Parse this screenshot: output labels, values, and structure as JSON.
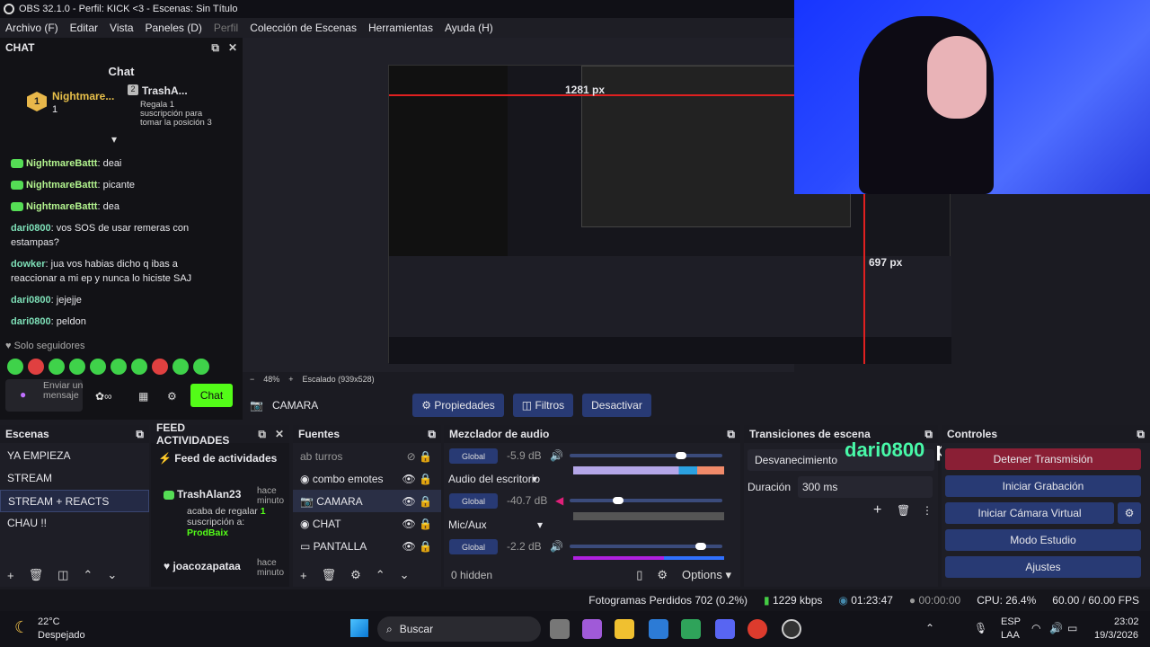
{
  "window": {
    "title": "OBS 32.1.0 - Perfil: KICK <3 - Escenas: Sin Título"
  },
  "menu": [
    "Archivo (F)",
    "Editar",
    "Vista",
    "Paneles (D)",
    "Perfil",
    "Colección de Escenas",
    "Herramientas",
    "Ayuda (H)"
  ],
  "chat": {
    "dock_title": "CHAT",
    "title": "Chat",
    "leader1": {
      "name": "Nightmare...",
      "count": "1",
      "rank": "1"
    },
    "leader2": {
      "name": "TrashA...",
      "count": "1",
      "rank": "2"
    },
    "gift_text": "Regala 1 suscripción para tomar la posición 3",
    "messages": [
      {
        "user": "NightmareBattt",
        "text": "deai",
        "type": "g"
      },
      {
        "user": "NightmareBattt",
        "text": "picante",
        "type": "g"
      },
      {
        "user": "NightmareBattt",
        "text": "dea",
        "type": "g"
      },
      {
        "user": "dari0800",
        "text": "vos SOS de usar remeras con estampas?",
        "type": "c"
      },
      {
        "user": "dowker",
        "text": "jua vos habias dicho q ibas a reaccionar a mi ep y nunca lo hiciste SAJ",
        "type": "c"
      },
      {
        "user": "dari0800",
        "text": "jejejje",
        "type": "c"
      },
      {
        "user": "dari0800",
        "text": "peldon",
        "type": "c"
      }
    ],
    "followers_only": "Solo seguidores",
    "input_placeholder": "Enviar un mensaje",
    "send_label": "Chat"
  },
  "preview": {
    "zoom": "48%",
    "scaled": "Escalado (939x528)",
    "measure_w": "1281 px",
    "measure_h": "697 px",
    "cam_name": "dari0800",
    "cam_msg": "peldon"
  },
  "source_bar": {
    "source": "CAMARA",
    "properties": "Propiedades",
    "filters": "Filtros",
    "deactivate": "Desactivar"
  },
  "scenes": {
    "title": "Escenas",
    "items": [
      "YA EMPIEZA",
      "STREAM",
      "STREAM + REACTS",
      "CHAU !!"
    ],
    "selected": 2
  },
  "activity": {
    "title": "FEED ACTIVIDADES",
    "header": "Feed de actividades",
    "item1": {
      "user": "TrashAlan23",
      "when": "hace minuto",
      "line1": "acaba de regalar",
      "count": "1",
      "line2": "suscripción a:",
      "target": "ProdBaix"
    },
    "item2": {
      "user": "joacozapataa",
      "when": "hace minuto"
    }
  },
  "sources": {
    "title": "Fuentes",
    "items": [
      "turros",
      "combo emotes",
      "CAMARA",
      "CHAT",
      "PANTALLA"
    ]
  },
  "mixer": {
    "title": "Mezclador de audio",
    "global": "Global",
    "channels": [
      {
        "label": "",
        "db": "-5.9 dB",
        "level": 0.88
      },
      {
        "label": "Audio del escritorio",
        "db": "-40.7 dB",
        "level": 0.35
      },
      {
        "label": "Mic/Aux",
        "db": "-2.2 dB",
        "level": 0.9
      }
    ],
    "scale": [
      "-60",
      "-54",
      "-48",
      "-42",
      "-36",
      "-30",
      "-24",
      "-18",
      "-12",
      "-6",
      "0"
    ],
    "hidden": "0 hidden",
    "options": "Options"
  },
  "transitions": {
    "title": "Transiciones de escena",
    "type": "Desvanecimiento",
    "duration_label": "Duración",
    "duration": "300 ms"
  },
  "controls": {
    "title": "Controles",
    "stop": "Detener Transmisión",
    "record": "Iniciar Grabación",
    "vcam": "Iniciar Cámara Virtual",
    "studio": "Modo Estudio",
    "settings": "Ajustes"
  },
  "status": {
    "dropped": "Fotogramas Perdidos 702 (0.2%)",
    "kbps": "1229 kbps",
    "live": "01:23:47",
    "rec": "00:00:00",
    "cpu": "CPU: 26.4%",
    "fps": "60.00 / 60.00 FPS"
  },
  "taskbar": {
    "temp": "22°C",
    "weather": "Despejado",
    "search": "Buscar",
    "lang1": "ESP",
    "lang2": "LAA",
    "time": "23:02",
    "date": "19/3/2026"
  },
  "colors": {
    "accent": "#283a74",
    "kick": "#53fc18",
    "stop": "#8a1f35"
  }
}
